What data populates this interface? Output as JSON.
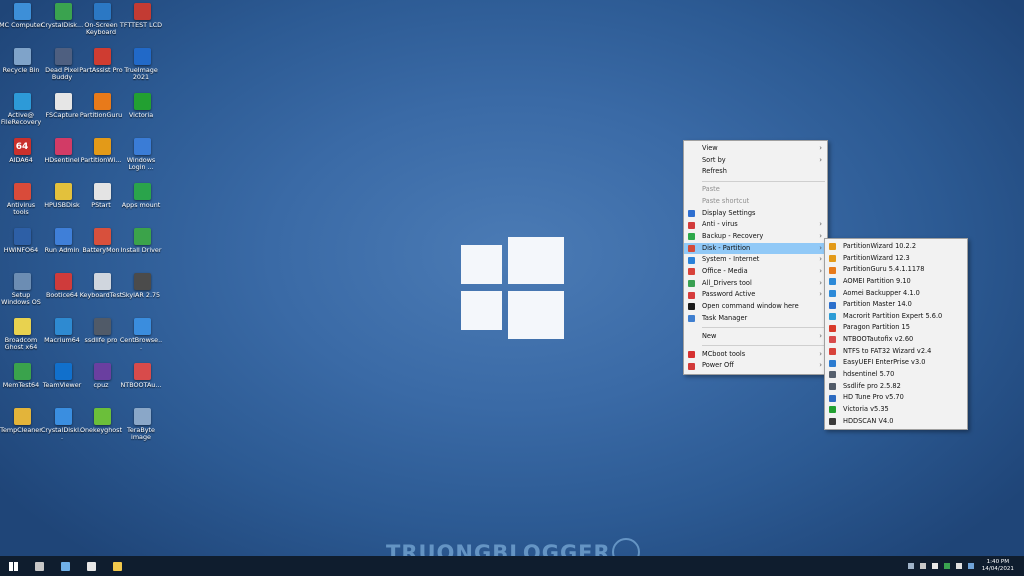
{
  "desktop_icons": [
    {
      "label": "MC Computer",
      "icon": "computer-icon",
      "color": "#3d8fd8"
    },
    {
      "label": "CrystalDisk...",
      "icon": "crystaldisk-icon",
      "color": "#3aa34f"
    },
    {
      "label": "On-Screen Keyboard",
      "icon": "keyboard-icon",
      "color": "#2b78c4"
    },
    {
      "label": "TFTTEST LCD",
      "icon": "tfttest-icon",
      "color": "#c33b33"
    },
    {
      "label": "Recycle Bin",
      "icon": "recycle-bin-icon",
      "color": "#7fa3c9"
    },
    {
      "label": "Dead Pixel Buddy",
      "icon": "monitor-icon",
      "color": "#4e5f80"
    },
    {
      "label": "PartAssist Pro",
      "icon": "partassist-icon",
      "color": "#cf3c31"
    },
    {
      "label": "TrueImage 2021",
      "icon": "trueimage-icon",
      "color": "#2169c8"
    },
    {
      "label": "Active@ FileRecovery",
      "icon": "filerecovery-icon",
      "color": "#2d9ad8"
    },
    {
      "label": "FSCapture",
      "icon": "fscapture-icon",
      "color": "#e6e6e6"
    },
    {
      "label": "PartitionGuru",
      "icon": "partitionguru-icon",
      "color": "#e87a1a"
    },
    {
      "label": "Victoria",
      "icon": "victoria-icon",
      "color": "#22a031"
    },
    {
      "label": "AIDA64",
      "icon": "aida64-icon",
      "glyph": "64",
      "color": "#c9302c"
    },
    {
      "label": "HDsentinel",
      "icon": "hdsentinel-icon",
      "color": "#d23b66"
    },
    {
      "label": "PartitionWi...",
      "icon": "partitionwizard-icon",
      "color": "#e39a18"
    },
    {
      "label": "Windows Login ...",
      "icon": "windows-login-icon",
      "color": "#3a7cd6"
    },
    {
      "label": "Antivirus tools",
      "icon": "antivirus-icon",
      "color": "#d94b3a"
    },
    {
      "label": "HPUSBDisk",
      "icon": "usb-disk-icon",
      "color": "#e3c13c"
    },
    {
      "label": "PStart",
      "icon": "pstart-icon",
      "color": "#e4e4e4"
    },
    {
      "label": "Apps mount",
      "icon": "apps-mount-icon",
      "color": "#2aa44b"
    },
    {
      "label": "HWiNFO64",
      "icon": "hwinfo-icon",
      "color": "#2d5fa6"
    },
    {
      "label": "Run Admin",
      "icon": "run-admin-icon",
      "color": "#3f7fd8"
    },
    {
      "label": "BatteryMon",
      "icon": "battery-icon",
      "color": "#d8503c"
    },
    {
      "label": "Install Driver",
      "icon": "install-driver-icon",
      "color": "#3ba34a"
    },
    {
      "label": "Setup Windows OS",
      "icon": "setup-windows-icon",
      "color": "#6c8db3"
    },
    {
      "label": "Bootice64",
      "icon": "bootice-icon",
      "color": "#cf3b3b"
    },
    {
      "label": "KeyboardTest",
      "icon": "keyboardtest-icon",
      "color": "#d0d6de"
    },
    {
      "label": "SkyIAR 2.75",
      "icon": "skyiar-icon",
      "color": "#4b4b4b"
    },
    {
      "label": "Broadcom Ghost x64",
      "icon": "ghost-icon",
      "color": "#e8d24f"
    },
    {
      "label": "Macrium64",
      "icon": "macrium-icon",
      "color": "#2e8ad1"
    },
    {
      "label": "ssdlife pro",
      "icon": "ssdlife-icon",
      "color": "#505a68"
    },
    {
      "label": "CentBrowse...",
      "icon": "centbrowser-icon",
      "color": "#3a8dde"
    },
    {
      "label": "MemTest64",
      "icon": "memtest-icon",
      "color": "#3aa34c"
    },
    {
      "label": "TeamViewer",
      "icon": "teamviewer-icon",
      "color": "#1170cc"
    },
    {
      "label": "cpuz",
      "icon": "cpuz-icon",
      "color": "#6a3fa0"
    },
    {
      "label": "NTBOOTAu...",
      "icon": "ntbootautofix-icon",
      "color": "#d84b4b"
    },
    {
      "label": "TempCleaner",
      "icon": "tempcleaner-icon",
      "color": "#e3b43a"
    },
    {
      "label": "CrystalDiskI...",
      "icon": "crystaldiskinfo-icon",
      "color": "#3a8ee0"
    },
    {
      "label": "Onekeyghost",
      "icon": "onekeyghost-icon",
      "color": "#6bbf3a"
    },
    {
      "label": "TeraByte image",
      "icon": "terabyte-icon",
      "color": "#8aa7c8"
    }
  ],
  "context_menu": {
    "items": [
      {
        "label": "View",
        "submenu": true
      },
      {
        "label": "Sort by",
        "submenu": true
      },
      {
        "label": "Refresh"
      },
      {
        "sep": true
      },
      {
        "label": "Paste",
        "disabled": true
      },
      {
        "label": "Paste shortcut",
        "disabled": true
      },
      {
        "label": "Display Settings",
        "icon": "display-settings-icon",
        "color": "#2f6fd0"
      },
      {
        "label": "Anti - virus",
        "icon": "anti-virus-icon",
        "color": "#d23b3b",
        "submenu": true
      },
      {
        "label": "Backup - Recovery",
        "icon": "backup-recovery-icon",
        "color": "#2da84a",
        "submenu": true
      },
      {
        "label": "Disk - Partition",
        "icon": "disk-partition-icon",
        "color": "#d34a3a",
        "submenu": true,
        "highlighted": true
      },
      {
        "label": "System - Internet",
        "icon": "system-internet-icon",
        "color": "#2b82d9",
        "submenu": true
      },
      {
        "label": "Office - Media",
        "icon": "office-media-icon",
        "color": "#d8423a",
        "submenu": true
      },
      {
        "label": "All_Drivers tool",
        "icon": "drivers-tool-icon",
        "color": "#3aa052",
        "submenu": true
      },
      {
        "label": "Password Active",
        "icon": "password-active-icon",
        "color": "#d63c3c",
        "submenu": true
      },
      {
        "label": "Open command window here",
        "icon": "command-window-icon",
        "color": "#1a1a1a"
      },
      {
        "label": "Task Manager",
        "icon": "task-manager-icon",
        "color": "#3f7fd0"
      },
      {
        "sep": true
      },
      {
        "label": "New",
        "submenu": true
      },
      {
        "sep": true
      },
      {
        "label": "MCboot tools",
        "icon": "mcboot-tools-icon",
        "color": "#d63131",
        "submenu": true
      },
      {
        "label": "Power Off",
        "icon": "power-off-icon",
        "color": "#d23a3a",
        "submenu": true
      }
    ]
  },
  "disk_partition_submenu": {
    "items": [
      {
        "label": "PartitionWizard 10.2.2",
        "icon": "partitionwizard-icon",
        "color": "#e39a18"
      },
      {
        "label": "PartitionWizard 12.3",
        "icon": "partitionwizard-icon",
        "color": "#e39a18"
      },
      {
        "label": "PartitionGuru 5.4.1.1178",
        "icon": "partitionguru-icon",
        "color": "#e87a1a"
      },
      {
        "label": "AOMEI Partition 9.10",
        "icon": "aomei-partition-icon",
        "color": "#2d8ad8"
      },
      {
        "label": "Aomei Backupper 4.1.0",
        "icon": "aomei-backupper-icon",
        "color": "#2d8ad8"
      },
      {
        "label": "Partition Master 14.0",
        "icon": "partition-master-icon",
        "color": "#2a6fcc"
      },
      {
        "label": "Macrorit Partition Expert 5.6.0",
        "icon": "macrorit-icon",
        "color": "#2d9cd6"
      },
      {
        "label": "Paragon Partition 15",
        "icon": "paragon-icon",
        "color": "#d83a2a"
      },
      {
        "label": "NTBOOTautofix v2.60",
        "icon": "ntbootautofix-icon",
        "color": "#d84b4b"
      },
      {
        "label": "NTFS to FAT32 Wizard v2.4",
        "icon": "ntfs-fat32-icon",
        "color": "#d8423a"
      },
      {
        "label": "EasyUEFI EnterPrise v3.0",
        "icon": "easyuefi-icon",
        "color": "#2b7bd0"
      },
      {
        "label": "hdsentinel 5.70",
        "icon": "hdsentinel-icon",
        "color": "#555f6d"
      },
      {
        "label": "Ssdlife pro 2.5.82",
        "icon": "ssdlife-icon",
        "color": "#505a68"
      },
      {
        "label": "HD Tune Pro v5.70",
        "icon": "hdtune-icon",
        "color": "#2c6ac0"
      },
      {
        "label": "Victoria v5.35",
        "icon": "victoria-icon",
        "color": "#22a031"
      },
      {
        "label": "HDDSCAN V4.0",
        "icon": "hddscan-icon",
        "color": "#3a3a3a"
      }
    ]
  },
  "taskbar": {
    "pinned": [
      {
        "icon": "start-icon",
        "color": "#ffffff"
      },
      {
        "icon": "command-prompt-icon",
        "color": "#c7c7c7"
      },
      {
        "icon": "this-pc-icon",
        "color": "#6fb0e8"
      },
      {
        "icon": "task-manager-icon",
        "color": "#e7e7e7"
      },
      {
        "icon": "file-explorer-icon",
        "color": "#f2c94c"
      }
    ],
    "clock_time": "1:40 PM",
    "clock_date": "14/04/2021"
  },
  "watermark": "TRUONGBLOGGER"
}
